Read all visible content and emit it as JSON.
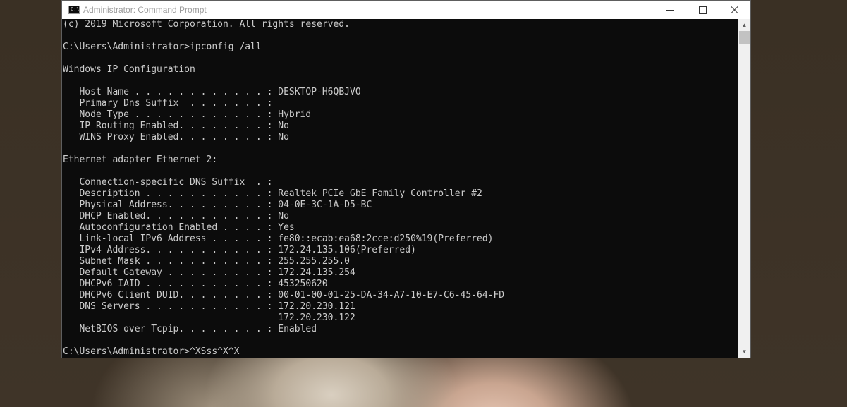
{
  "window": {
    "title": "Administrator: Command Prompt",
    "icon_text": "C:\\"
  },
  "console": {
    "lines": [
      "(c) 2019 Microsoft Corporation. All rights reserved.",
      "",
      "C:\\Users\\Administrator>ipconfig /all",
      "",
      "Windows IP Configuration",
      "",
      "   Host Name . . . . . . . . . . . . : DESKTOP-H6QBJVO",
      "   Primary Dns Suffix  . . . . . . . :",
      "   Node Type . . . . . . . . . . . . : Hybrid",
      "   IP Routing Enabled. . . . . . . . : No",
      "   WINS Proxy Enabled. . . . . . . . : No",
      "",
      "Ethernet adapter Ethernet 2:",
      "",
      "   Connection-specific DNS Suffix  . :",
      "   Description . . . . . . . . . . . : Realtek PCIe GbE Family Controller #2",
      "   Physical Address. . . . . . . . . : 04-0E-3C-1A-D5-BC",
      "   DHCP Enabled. . . . . . . . . . . : No",
      "   Autoconfiguration Enabled . . . . : Yes",
      "   Link-local IPv6 Address . . . . . : fe80::ecab:ea68:2cce:d250%19(Preferred)",
      "   IPv4 Address. . . . . . . . . . . : 172.24.135.106(Preferred)",
      "   Subnet Mask . . . . . . . . . . . : 255.255.255.0",
      "   Default Gateway . . . . . . . . . : 172.24.135.254",
      "   DHCPv6 IAID . . . . . . . . . . . : 453250620",
      "   DHCPv6 Client DUID. . . . . . . . : 00-01-00-01-25-DA-34-A7-10-E7-C6-45-64-FD",
      "   DNS Servers . . . . . . . . . . . : 172.20.230.121",
      "                                       172.20.230.122",
      "   NetBIOS over Tcpip. . . . . . . . : Enabled",
      "",
      "C:\\Users\\Administrator>^XSss^X^X"
    ]
  },
  "colors": {
    "console_bg": "#0c0c0c",
    "console_fg": "#cccccc",
    "titlebar_bg": "#ffffff"
  }
}
